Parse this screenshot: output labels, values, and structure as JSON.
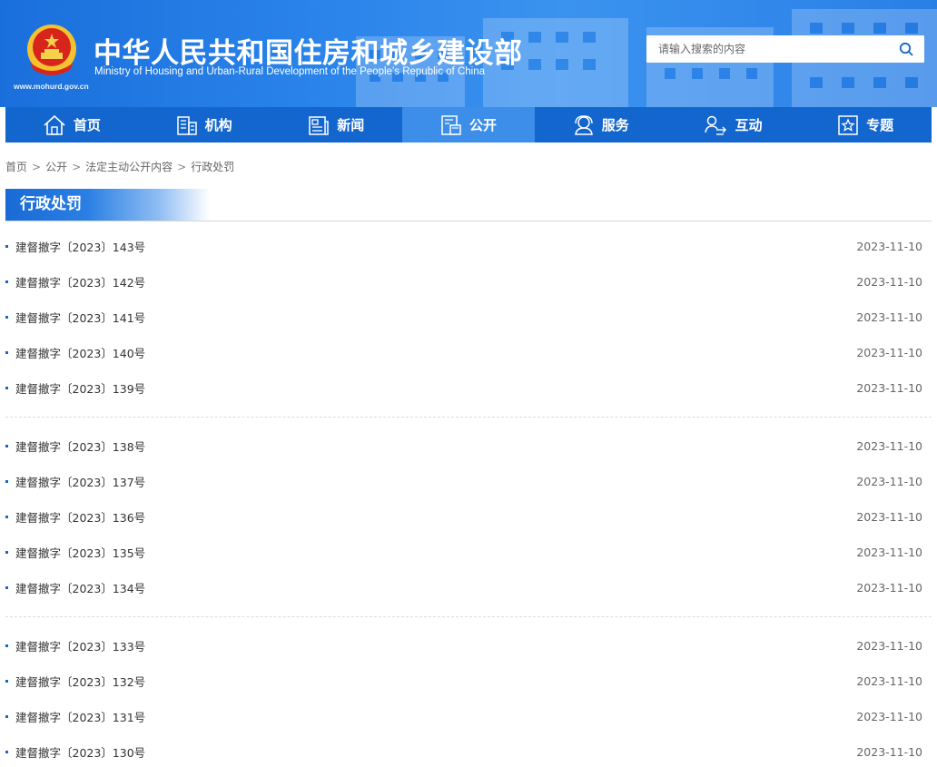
{
  "header": {
    "site_url": "www.mohurd.gov.cn",
    "title_cn": "中华人民共和国住房和城乡建设部",
    "title_en": "Ministry of Housing and Urban-Rural Development of the People’s Republic of China",
    "search_placeholder": "请输入搜索的内容"
  },
  "nav": [
    {
      "label": "首页",
      "icon": "home-icon"
    },
    {
      "label": "机构",
      "icon": "building-icon"
    },
    {
      "label": "新闻",
      "icon": "news-icon"
    },
    {
      "label": "公开",
      "icon": "disclosure-icon",
      "active": true
    },
    {
      "label": "服务",
      "icon": "service-icon"
    },
    {
      "label": "互动",
      "icon": "interaction-icon"
    },
    {
      "label": "专题",
      "icon": "topic-icon"
    }
  ],
  "breadcrumb": [
    "首页",
    "公开",
    "法定主动公开内容",
    "行政处罚"
  ],
  "section_title": "行政处罚",
  "groups": [
    [
      {
        "title": "建督撤字〔2023〕143号",
        "date": "2023-11-10"
      },
      {
        "title": "建督撤字〔2023〕142号",
        "date": "2023-11-10"
      },
      {
        "title": "建督撤字〔2023〕141号",
        "date": "2023-11-10"
      },
      {
        "title": "建督撤字〔2023〕140号",
        "date": "2023-11-10"
      },
      {
        "title": "建督撤字〔2023〕139号",
        "date": "2023-11-10"
      }
    ],
    [
      {
        "title": "建督撤字〔2023〕138号",
        "date": "2023-11-10"
      },
      {
        "title": "建督撤字〔2023〕137号",
        "date": "2023-11-10"
      },
      {
        "title": "建督撤字〔2023〕136号",
        "date": "2023-11-10"
      },
      {
        "title": "建督撤字〔2023〕135号",
        "date": "2023-11-10"
      },
      {
        "title": "建督撤字〔2023〕134号",
        "date": "2023-11-10"
      }
    ],
    [
      {
        "title": "建督撤字〔2023〕133号",
        "date": "2023-11-10"
      },
      {
        "title": "建督撤字〔2023〕132号",
        "date": "2023-11-10"
      },
      {
        "title": "建督撤字〔2023〕131号",
        "date": "2023-11-10"
      },
      {
        "title": "建督撤字〔2023〕130号",
        "date": "2023-11-10"
      }
    ]
  ],
  "colors": {
    "primary": "#1466cf",
    "nav_active": "#3c8ee8",
    "header_bg": "#2a84ea"
  }
}
